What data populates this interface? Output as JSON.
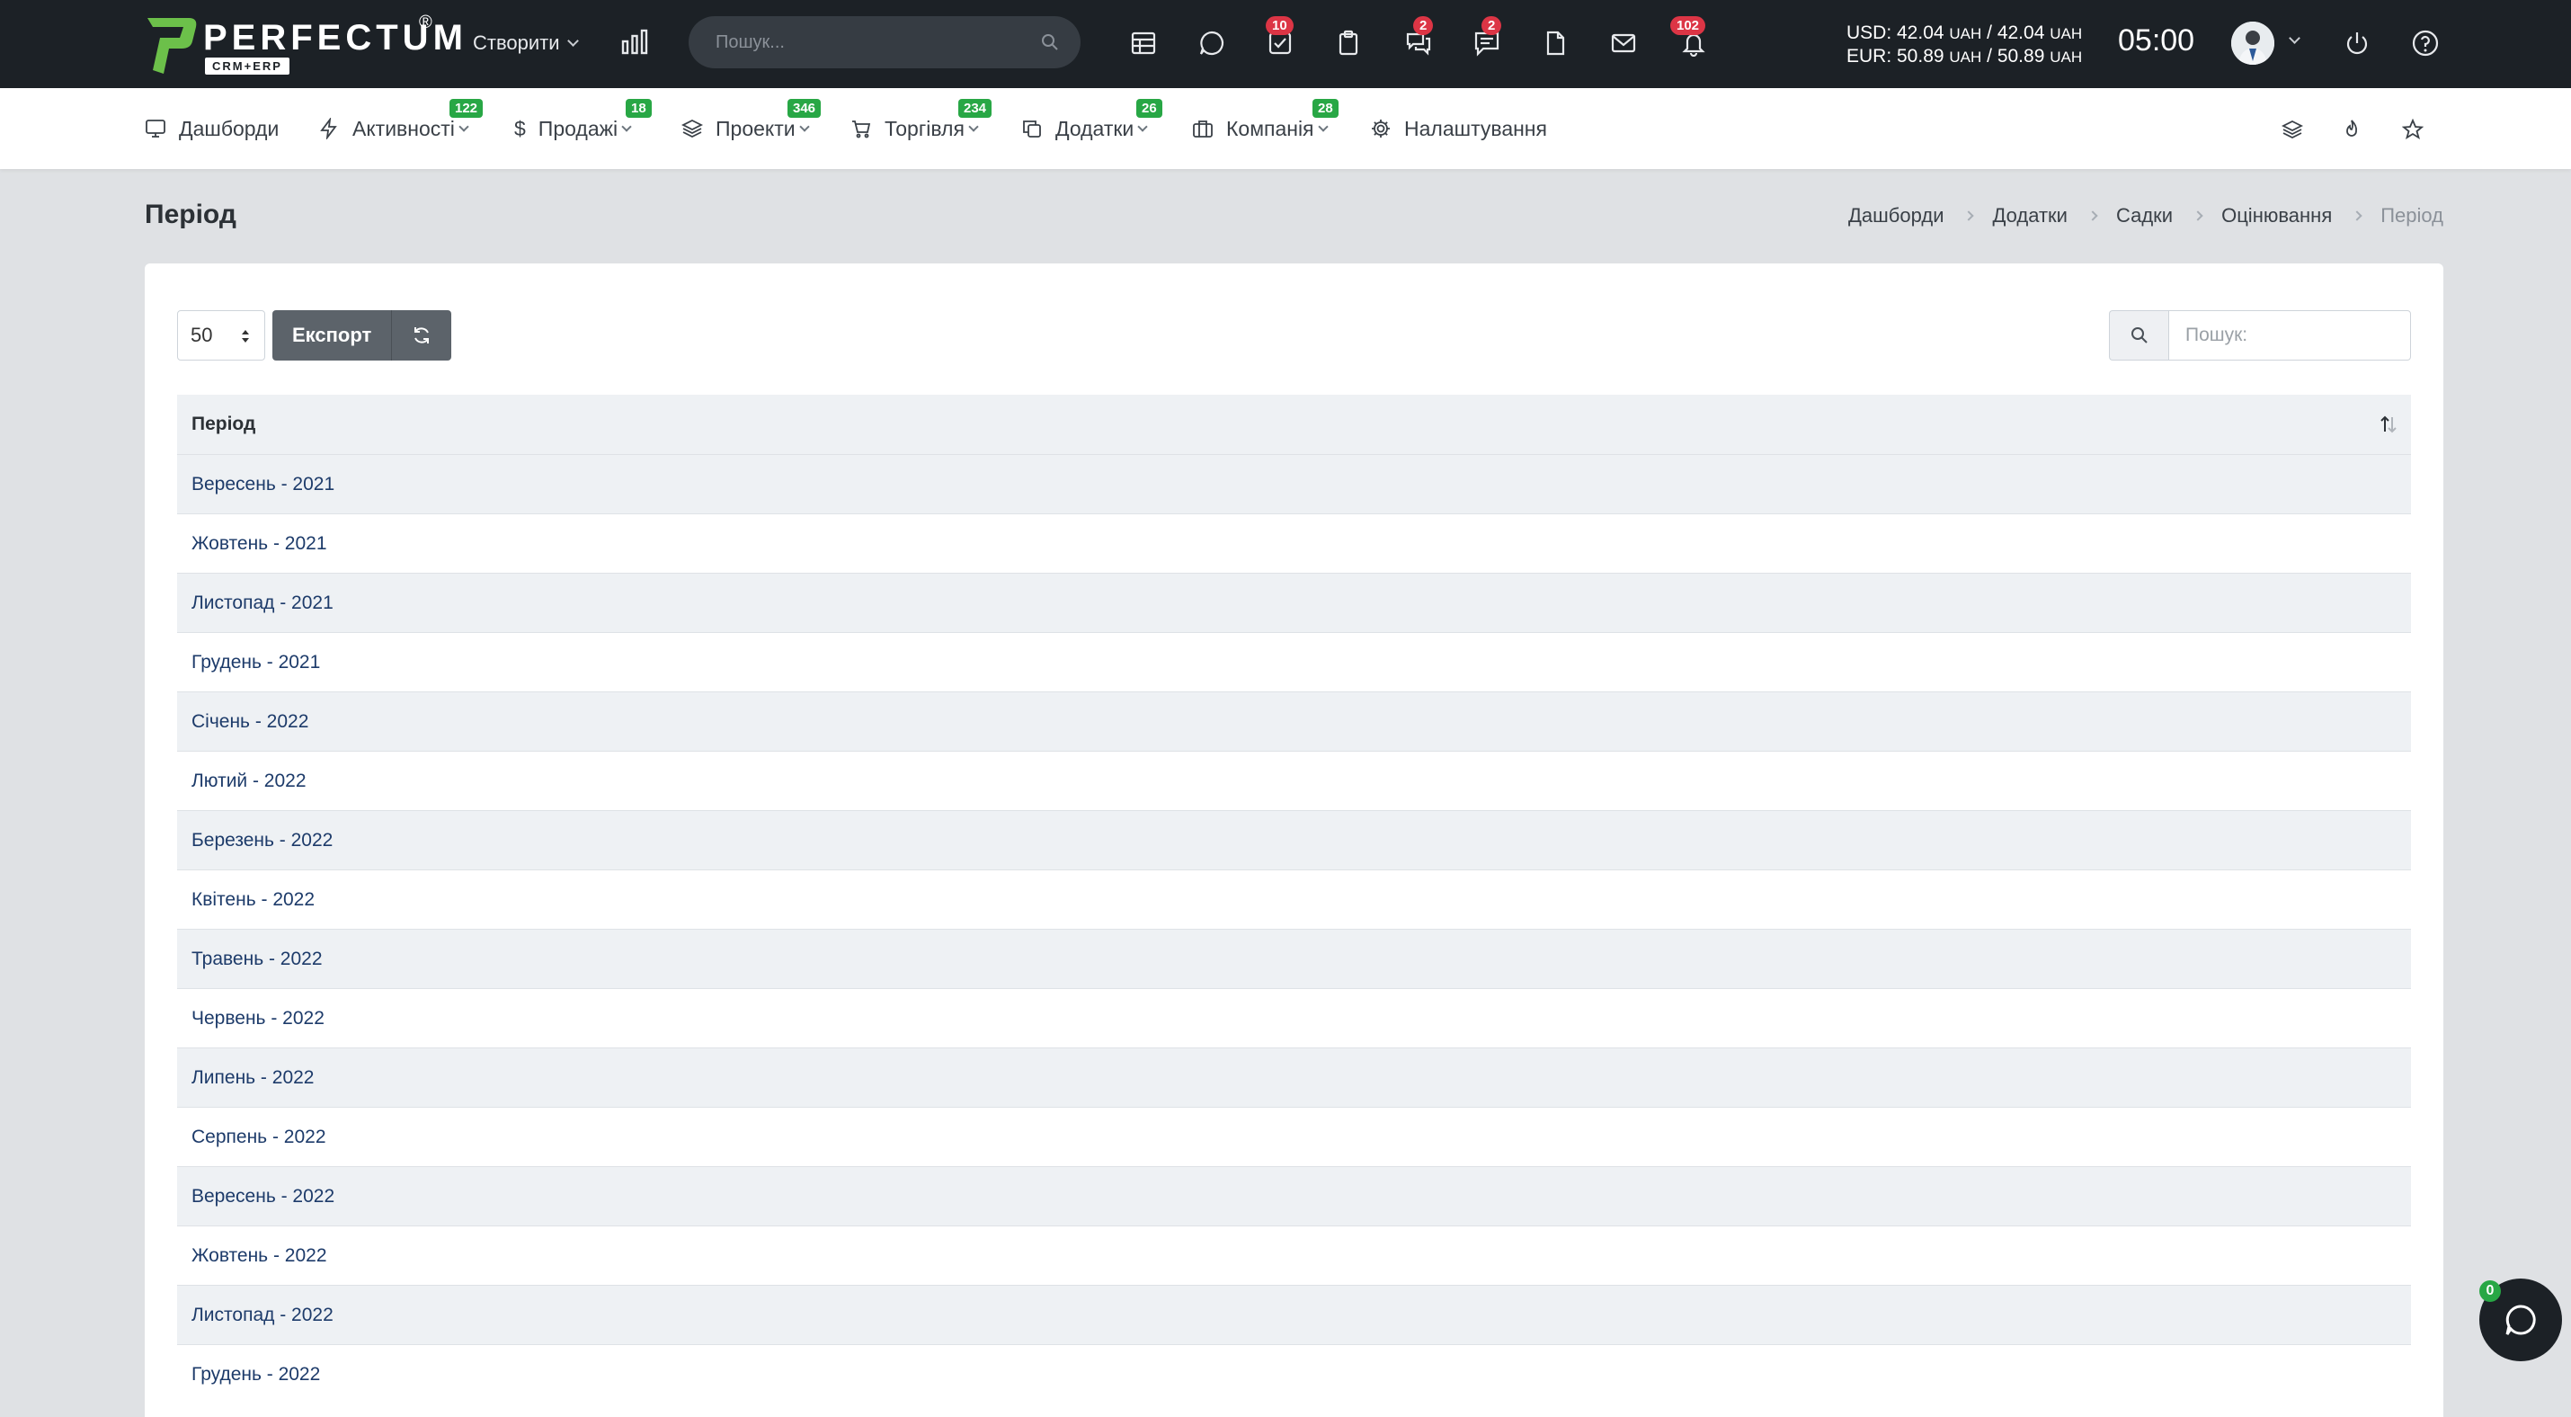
{
  "header": {
    "logo_text": "PERFECTUM",
    "logo_sub": "CRM+ERP",
    "logo_reg": "®",
    "create_label": "Створити",
    "search_placeholder": "Пошук...",
    "badges": {
      "tasks": "10",
      "discussions": "2",
      "comments": "2",
      "notifications": "102"
    },
    "rates": {
      "usd_prefix": "USD: 42.04",
      "usd_mid": "/ 42.04",
      "eur_prefix": "EUR: 50.89",
      "eur_mid": "/ 50.89",
      "unit": "UAH"
    },
    "clock": "05:00"
  },
  "nav": {
    "items": [
      {
        "label": "Дашборди",
        "badge": ""
      },
      {
        "label": "Активності",
        "badge": "122"
      },
      {
        "label": "Продажі",
        "badge": "18"
      },
      {
        "label": "Проекти",
        "badge": "346"
      },
      {
        "label": "Торгівля",
        "badge": "234"
      },
      {
        "label": "Додатки",
        "badge": "26"
      },
      {
        "label": "Компанія",
        "badge": "28"
      },
      {
        "label": "Налаштування",
        "badge": ""
      }
    ]
  },
  "page": {
    "title": "Період",
    "breadcrumb": [
      "Дашборди",
      "Додатки",
      "Садки",
      "Оцінювання",
      "Період"
    ]
  },
  "toolbar": {
    "page_length": "50",
    "export_label": "Експорт",
    "search_placeholder": "Пошук:"
  },
  "table": {
    "column": "Період",
    "rows": [
      "Вересень - 2021",
      "Жовтень - 2021",
      "Листопад - 2021",
      "Грудень - 2021",
      "Січень - 2022",
      "Лютий - 2022",
      "Березень - 2022",
      "Квітень - 2022",
      "Травень - 2022",
      "Червень - 2022",
      "Липень - 2022",
      "Серпень - 2022",
      "Вересень - 2022",
      "Жовтень - 2022",
      "Листопад - 2022",
      "Грудень - 2022"
    ]
  },
  "chat": {
    "badge": "0"
  },
  "colors": {
    "header_bg": "#1c2126",
    "badge_red": "#dc3545",
    "badge_green": "#28a745",
    "link": "#1d3b6a",
    "logo_green": "#6cc04a"
  }
}
